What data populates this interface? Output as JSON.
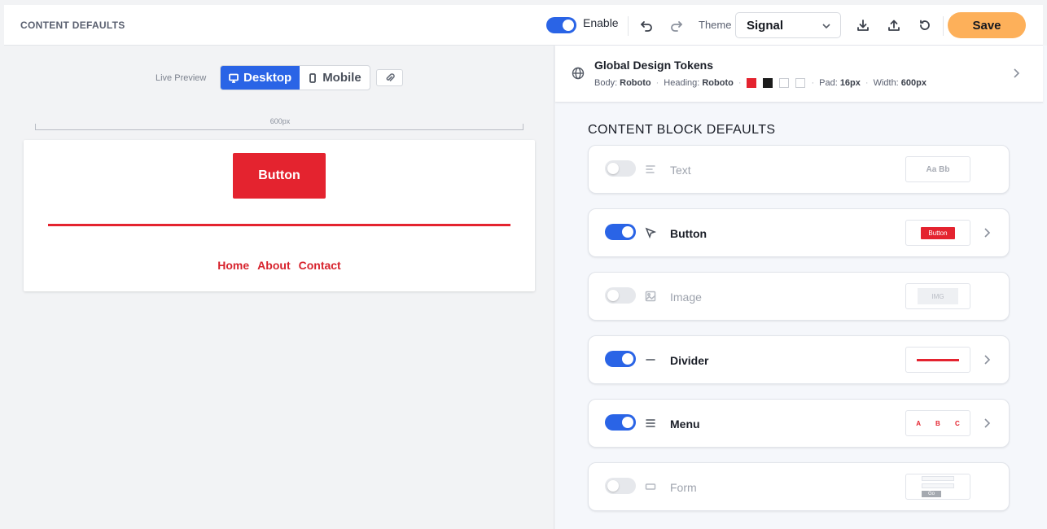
{
  "header": {
    "title": "CONTENT DEFAULTS",
    "enable_label": "Enable",
    "theme_label": "Theme",
    "theme_value": "Signal",
    "save_label": "Save",
    "enabled": true,
    "accent_color": "#2a64e6",
    "save_color": "#fdb05a"
  },
  "preview": {
    "live_label": "Live Preview",
    "desktop_label": "Desktop",
    "mobile_label": "Mobile",
    "active_mode": "Desktop",
    "ruler_label": "600px",
    "button_label": "Button",
    "menu_items": [
      "Home",
      "About",
      "Contact"
    ],
    "brand_color": "#e4232f"
  },
  "tokens": {
    "title": "Global Design Tokens",
    "body_label": "Body:",
    "body_font": "Roboto",
    "heading_label": "Heading:",
    "heading_font": "Roboto",
    "swatches": [
      "#e4232f",
      "#1c1c1c",
      "#ffffff",
      "#ffffff"
    ],
    "pad_label": "Pad:",
    "pad_value": "16px",
    "width_label": "Width:",
    "width_value": "600px"
  },
  "blocks": {
    "section_title": "CONTENT BLOCK DEFAULTS",
    "items": [
      {
        "name": "Text",
        "enabled": false,
        "icon": "text-align-icon",
        "thumb": "Aa Bb"
      },
      {
        "name": "Button",
        "enabled": true,
        "icon": "cursor-icon",
        "thumb": "Button"
      },
      {
        "name": "Image",
        "enabled": false,
        "icon": "image-icon",
        "thumb": "IMG"
      },
      {
        "name": "Divider",
        "enabled": true,
        "icon": "minus-icon",
        "thumb": ""
      },
      {
        "name": "Menu",
        "enabled": true,
        "icon": "menu-icon",
        "thumb": "A B C"
      },
      {
        "name": "Form",
        "enabled": false,
        "icon": "form-icon",
        "thumb": "Go"
      }
    ]
  }
}
